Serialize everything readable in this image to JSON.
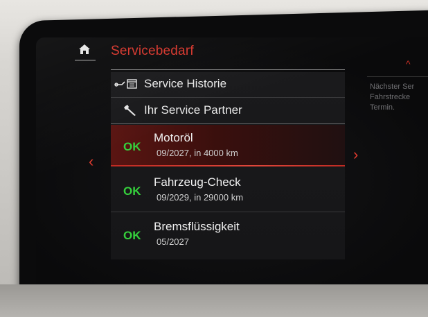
{
  "header": {
    "title": "Servicebedarf",
    "home_icon": "home-icon"
  },
  "menu": {
    "links": [
      {
        "label": "Service Historie",
        "icon": "service-history-icon"
      },
      {
        "label": "Ihr Service Partner",
        "icon": "wrench-icon"
      }
    ],
    "services": [
      {
        "status": "OK",
        "name": "Motoröl",
        "detail": "09/2027, in 4000 km",
        "selected": true
      },
      {
        "status": "OK",
        "name": "Fahrzeug-Check",
        "detail": "09/2029, in 29000 km",
        "selected": false
      },
      {
        "status": "OK",
        "name": "Bremsflüssigkeit",
        "detail": "05/2027",
        "selected": false
      }
    ]
  },
  "side_info": {
    "lines": [
      "Nächster Ser",
      "Fahrstrecke",
      "Termin."
    ]
  },
  "colors": {
    "accent": "#d8362c",
    "ok": "#35d03c",
    "text": "#e8e8e8"
  }
}
